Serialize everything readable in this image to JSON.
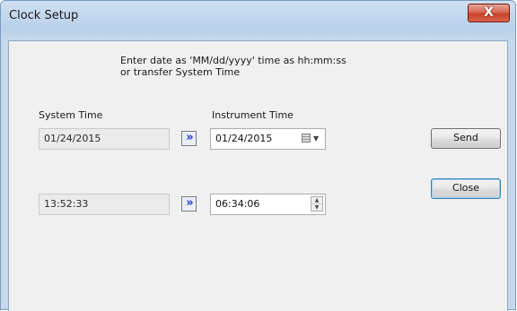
{
  "window": {
    "title": "Clock Setup",
    "close_glyph": "X"
  },
  "instructions": {
    "line1": "Enter date as 'MM/dd/yyyy' time as hh:mm:ss",
    "line2": "or transfer System Time"
  },
  "system": {
    "label": "System Time",
    "date": "01/24/2015",
    "time": "13:52:33"
  },
  "instrument": {
    "label": "Instrument Time",
    "date": "01/24/2015",
    "time": "06:34:06"
  },
  "transfer_glyph": "»",
  "buttons": {
    "send": "Send",
    "close": "Close"
  },
  "icons": {
    "transfer": "double-chevron-right-icon",
    "calendar": "calendar-icon",
    "dropdown": "chevron-down-icon",
    "spin_up": "spin-up-icon",
    "spin_down": "spin-down-icon"
  },
  "colors": {
    "transfer_accent": "#1c2fd6",
    "close_button": "#c7432b",
    "title_bar": "#b9d1ea"
  }
}
